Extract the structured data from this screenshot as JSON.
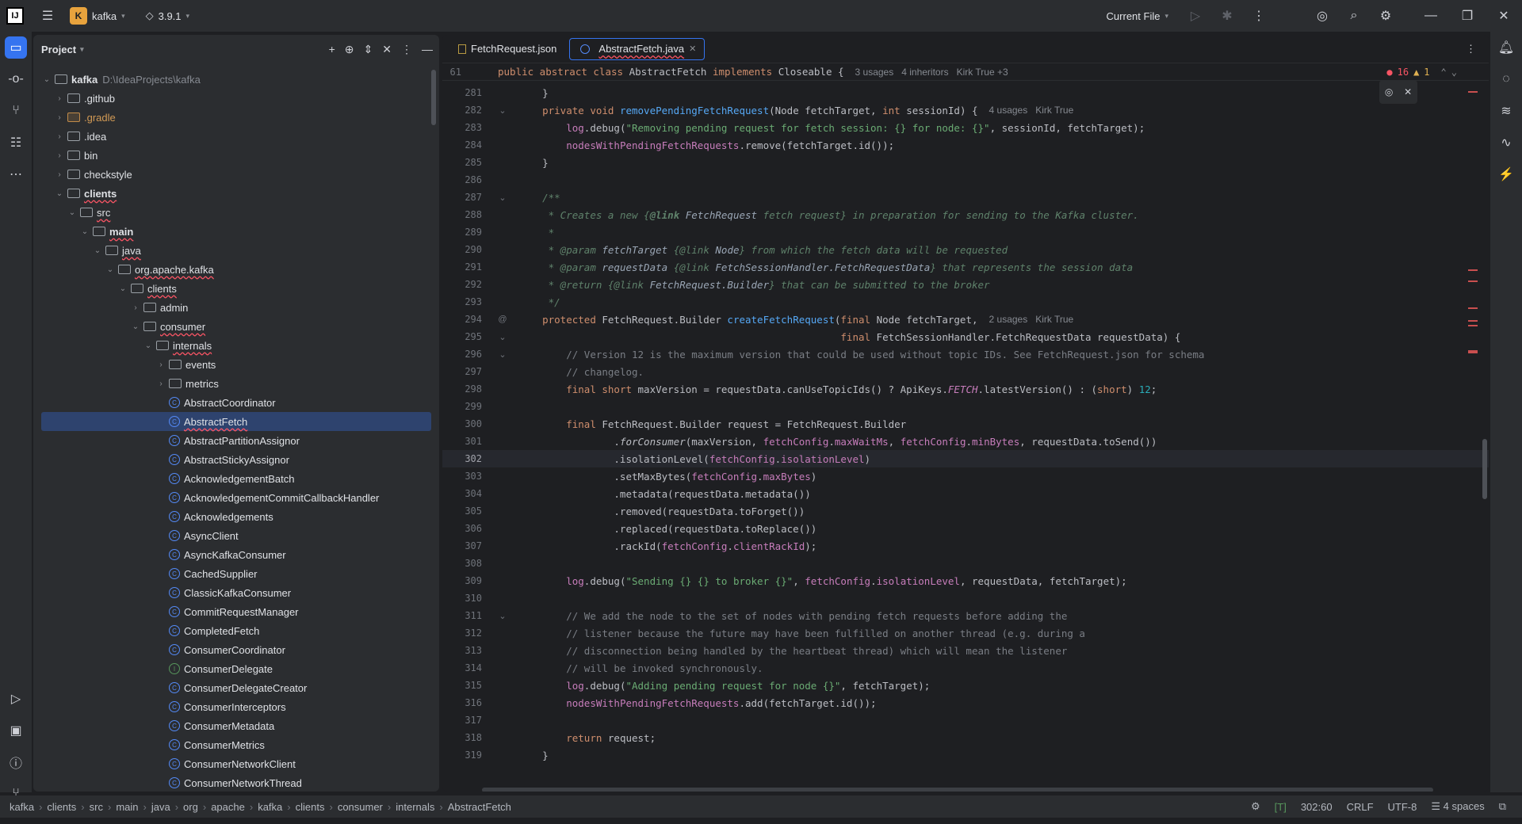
{
  "titlebar": {
    "project_badge": "K",
    "project_name": "kafka",
    "branch": "3.9.1",
    "run_config": "Current File"
  },
  "project_panel": {
    "title": "Project",
    "root_name": "kafka",
    "root_path": "D:\\IdeaProjects\\kafka",
    "items": [
      {
        "label": ".github",
        "depth": 1,
        "type": "folder",
        "expanded": false
      },
      {
        "label": ".gradle",
        "depth": 1,
        "type": "folder-gradle",
        "expanded": false
      },
      {
        "label": ".idea",
        "depth": 1,
        "type": "folder",
        "expanded": false
      },
      {
        "label": "bin",
        "depth": 1,
        "type": "folder",
        "expanded": false
      },
      {
        "label": "checkstyle",
        "depth": 1,
        "type": "folder",
        "expanded": false
      },
      {
        "label": "clients",
        "depth": 1,
        "type": "module",
        "expanded": true
      },
      {
        "label": "src",
        "depth": 2,
        "type": "folder",
        "expanded": true
      },
      {
        "label": "main",
        "depth": 3,
        "type": "folder",
        "expanded": true
      },
      {
        "label": "java",
        "depth": 4,
        "type": "folder",
        "expanded": true
      },
      {
        "label": "org.apache.kafka",
        "depth": 5,
        "type": "package",
        "expanded": true
      },
      {
        "label": "clients",
        "depth": 6,
        "type": "package",
        "expanded": true
      },
      {
        "label": "admin",
        "depth": 7,
        "type": "package",
        "expanded": false
      },
      {
        "label": "consumer",
        "depth": 7,
        "type": "package",
        "expanded": true
      },
      {
        "label": "internals",
        "depth": 8,
        "type": "package",
        "expanded": true
      },
      {
        "label": "events",
        "depth": 9,
        "type": "package",
        "expanded": false
      },
      {
        "label": "metrics",
        "depth": 9,
        "type": "package",
        "expanded": false
      },
      {
        "label": "AbstractCoordinator",
        "depth": 9,
        "type": "class"
      },
      {
        "label": "AbstractFetch",
        "depth": 9,
        "type": "class",
        "selected": true
      },
      {
        "label": "AbstractPartitionAssignor",
        "depth": 9,
        "type": "class"
      },
      {
        "label": "AbstractStickyAssignor",
        "depth": 9,
        "type": "class"
      },
      {
        "label": "AcknowledgementBatch",
        "depth": 9,
        "type": "class"
      },
      {
        "label": "AcknowledgementCommitCallbackHandler",
        "depth": 9,
        "type": "class"
      },
      {
        "label": "Acknowledgements",
        "depth": 9,
        "type": "class"
      },
      {
        "label": "AsyncClient",
        "depth": 9,
        "type": "class"
      },
      {
        "label": "AsyncKafkaConsumer",
        "depth": 9,
        "type": "class"
      },
      {
        "label": "CachedSupplier",
        "depth": 9,
        "type": "class"
      },
      {
        "label": "ClassicKafkaConsumer",
        "depth": 9,
        "type": "class"
      },
      {
        "label": "CommitRequestManager",
        "depth": 9,
        "type": "class"
      },
      {
        "label": "CompletedFetch",
        "depth": 9,
        "type": "class"
      },
      {
        "label": "ConsumerCoordinator",
        "depth": 9,
        "type": "class"
      },
      {
        "label": "ConsumerDelegate",
        "depth": 9,
        "type": "interface"
      },
      {
        "label": "ConsumerDelegateCreator",
        "depth": 9,
        "type": "class"
      },
      {
        "label": "ConsumerInterceptors",
        "depth": 9,
        "type": "class"
      },
      {
        "label": "ConsumerMetadata",
        "depth": 9,
        "type": "class"
      },
      {
        "label": "ConsumerMetrics",
        "depth": 9,
        "type": "class"
      },
      {
        "label": "ConsumerNetworkClient",
        "depth": 9,
        "type": "class"
      },
      {
        "label": "ConsumerNetworkThread",
        "depth": 9,
        "type": "class"
      }
    ]
  },
  "editor": {
    "tabs": [
      {
        "label": "FetchRequest.json",
        "active": false
      },
      {
        "label": "AbstractFetch.java",
        "active": true
      }
    ],
    "sticky_line_number": "61",
    "sticky_code": "public abstract class AbstractFetch implements Closeable {",
    "sticky_hint_usages": "3 usages",
    "sticky_hint_inheritors": "4 inheritors",
    "sticky_hint_author": "Kirk True +3",
    "errors": "16",
    "warnings": "1",
    "hint_usages_4": "4 usages",
    "hint_usages_2": "2 usages",
    "hint_author": "Kirk True"
  },
  "statusbar": {
    "breadcrumbs": [
      "kafka",
      "clients",
      "src",
      "main",
      "java",
      "org",
      "apache",
      "kafka",
      "clients",
      "consumer",
      "internals",
      "AbstractFetch"
    ],
    "position": "302:60",
    "line_sep": "CRLF",
    "encoding": "UTF-8",
    "indent": "4 spaces"
  }
}
